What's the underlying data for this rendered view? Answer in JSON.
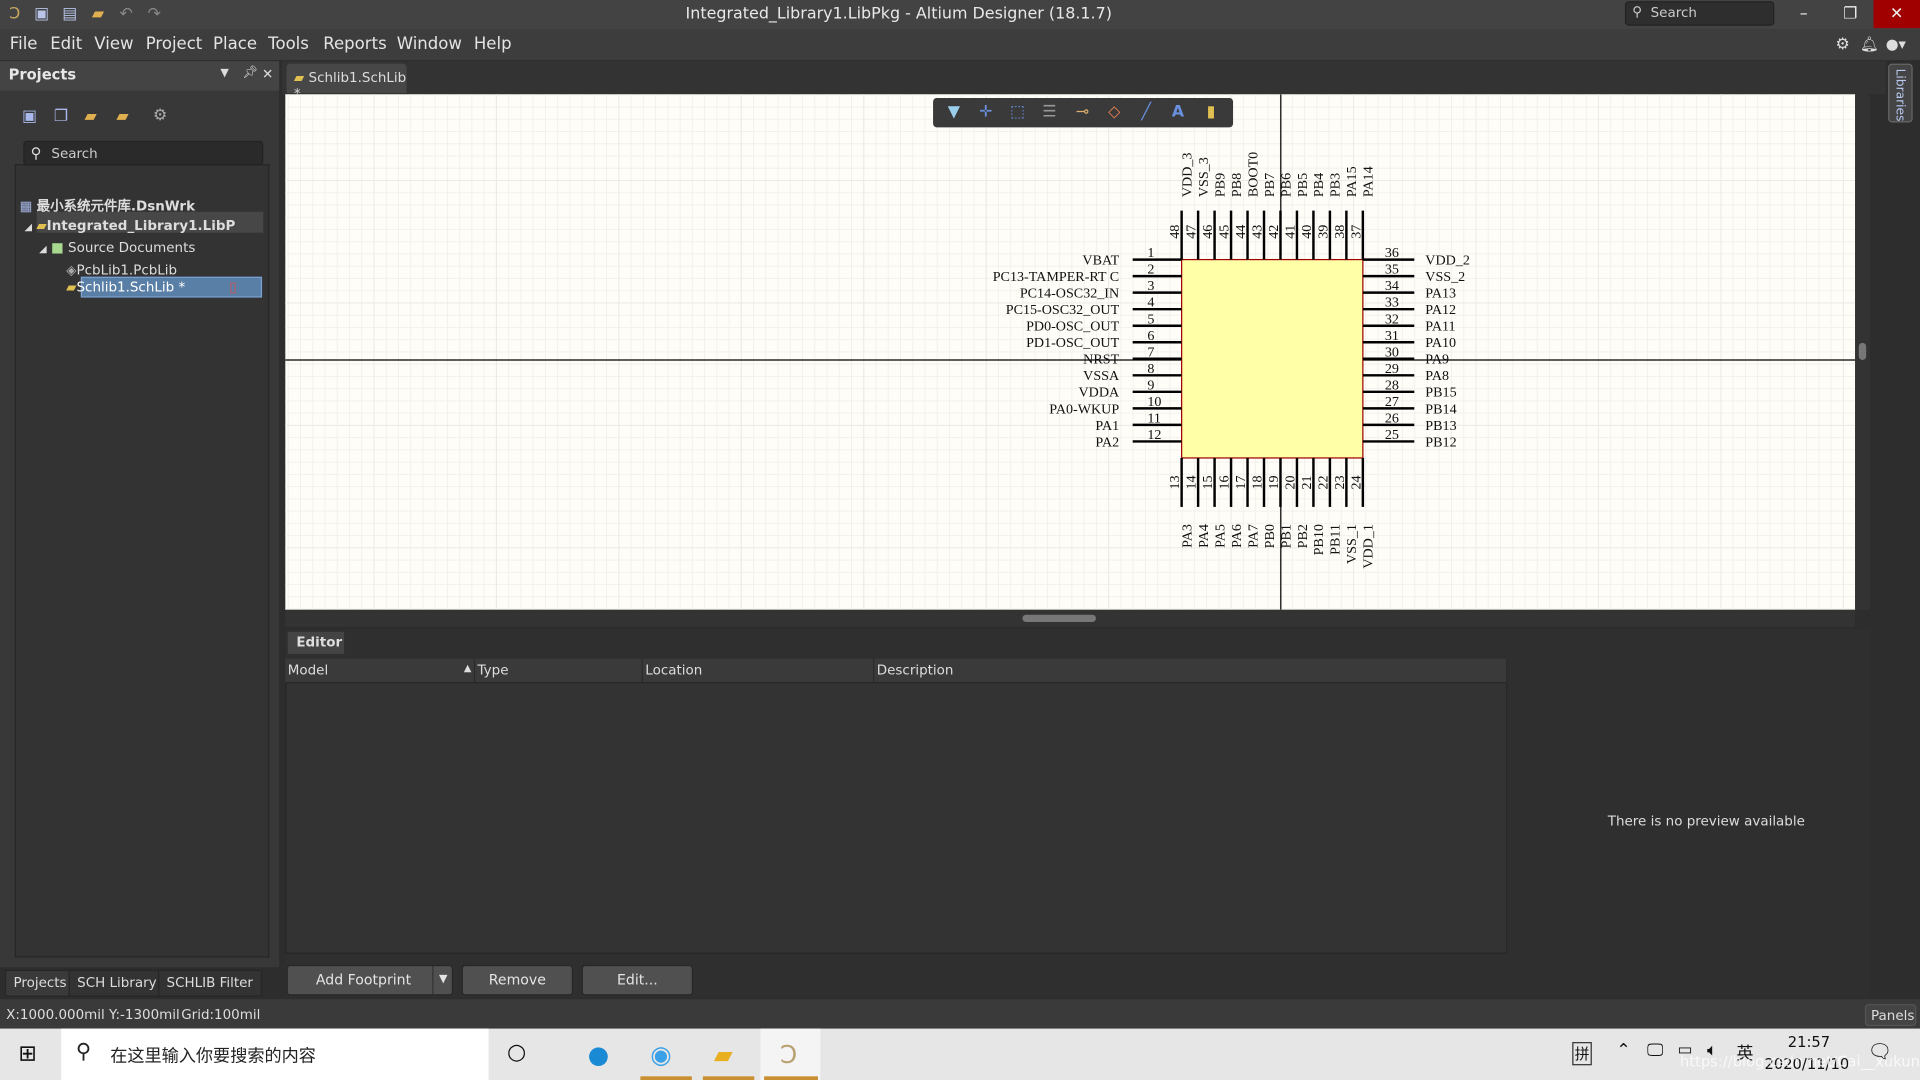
{
  "window": {
    "title": "Integrated_Library1.LibPkg - Altium Designer (18.1.7)",
    "search_placeholder": "Search",
    "minimize": "–",
    "restore": "❐",
    "close": "✕"
  },
  "quick_access": [
    {
      "icon": "altium-logo-icon"
    },
    {
      "icon": "save-icon"
    },
    {
      "icon": "save-all-icon"
    },
    {
      "icon": "open-icon"
    },
    {
      "icon": "undo-icon"
    },
    {
      "icon": "redo-icon"
    }
  ],
  "menu": [
    "File",
    "Edit",
    "View",
    "Project",
    "Place",
    "Tools",
    "Reports",
    "Window",
    "Help"
  ],
  "projects_panel": {
    "title": "Projects",
    "search_placeholder": "Search",
    "tree": [
      {
        "label": "最小系统元件库.DsnWrk",
        "level": 0,
        "bold": true
      },
      {
        "label": "Integrated_Library1.LibP",
        "level": 1,
        "bold": true,
        "expanded": true
      },
      {
        "label": "Source Documents",
        "level": 2,
        "expanded": true
      },
      {
        "label": "PcbLib1.PcbLib",
        "level": 3
      },
      {
        "label": "Schlib1.SchLib *",
        "level": 3,
        "selected": true
      }
    ],
    "bottom_tabs": [
      "Projects",
      "SCH Library",
      "SCHLIB Filter"
    ]
  },
  "doc_tab": "Schlib1.SchLib *",
  "right_strip": "Libraries",
  "schematic": {
    "body_color": "#ffffa8",
    "border_color": "#a00000",
    "left_pins": [
      {
        "num": "1",
        "name": "VBAT"
      },
      {
        "num": "2",
        "name": "PC13-TAMPER-RT C"
      },
      {
        "num": "3",
        "name": "PC14-OSC32_IN"
      },
      {
        "num": "4",
        "name": "PC15-OSC32_OUT"
      },
      {
        "num": "5",
        "name": "PD0-OSC_OUT"
      },
      {
        "num": "6",
        "name": "PD1-OSC_OUT"
      },
      {
        "num": "7",
        "name": "NRST"
      },
      {
        "num": "8",
        "name": "VSSA"
      },
      {
        "num": "9",
        "name": "VDDA"
      },
      {
        "num": "10",
        "name": "PA0-WKUP"
      },
      {
        "num": "11",
        "name": "PA1"
      },
      {
        "num": "12",
        "name": "PA2"
      }
    ],
    "right_pins": [
      {
        "num": "36",
        "name": "VDD_2"
      },
      {
        "num": "35",
        "name": "VSS_2"
      },
      {
        "num": "34",
        "name": "PA13"
      },
      {
        "num": "33",
        "name": "PA12"
      },
      {
        "num": "32",
        "name": "PA11"
      },
      {
        "num": "31",
        "name": "PA10"
      },
      {
        "num": "30",
        "name": "PA9"
      },
      {
        "num": "29",
        "name": "PA8"
      },
      {
        "num": "28",
        "name": "PB15"
      },
      {
        "num": "27",
        "name": "PB14"
      },
      {
        "num": "26",
        "name": "PB13"
      },
      {
        "num": "25",
        "name": "PB12"
      }
    ],
    "top_pins": [
      {
        "num": "48",
        "name": "VDD_3"
      },
      {
        "num": "47",
        "name": "VSS_3"
      },
      {
        "num": "46",
        "name": "PB9"
      },
      {
        "num": "45",
        "name": "PB8"
      },
      {
        "num": "44",
        "name": "BOOT0"
      },
      {
        "num": "43",
        "name": "PB7"
      },
      {
        "num": "42",
        "name": "PB6"
      },
      {
        "num": "41",
        "name": "PB5"
      },
      {
        "num": "40",
        "name": "PB4"
      },
      {
        "num": "39",
        "name": "PB3"
      },
      {
        "num": "38",
        "name": "PA15"
      },
      {
        "num": "37",
        "name": "PA14"
      }
    ],
    "bottom_pins": [
      {
        "num": "13",
        "name": "PA3"
      },
      {
        "num": "14",
        "name": "PA4"
      },
      {
        "num": "15",
        "name": "PA5"
      },
      {
        "num": "16",
        "name": "PA6"
      },
      {
        "num": "17",
        "name": "PA7"
      },
      {
        "num": "18",
        "name": "PB0"
      },
      {
        "num": "19",
        "name": "PB1"
      },
      {
        "num": "20",
        "name": "PB2"
      },
      {
        "num": "21",
        "name": "PB10"
      },
      {
        "num": "22",
        "name": "PB11"
      },
      {
        "num": "23",
        "name": "VSS_1"
      },
      {
        "num": "24",
        "name": "VDD_1"
      }
    ]
  },
  "active_bar": [
    {
      "icon": "filter-icon"
    },
    {
      "icon": "move-icon"
    },
    {
      "icon": "select-rect-icon"
    },
    {
      "icon": "align-icon"
    },
    {
      "icon": "place-pin-icon"
    },
    {
      "icon": "eraser-icon"
    },
    {
      "icon": "line-icon"
    },
    {
      "icon": "text-icon"
    },
    {
      "icon": "part-icon"
    }
  ],
  "editor": {
    "tab": "Editor",
    "columns": [
      "Model",
      "Type",
      "Location",
      "Description"
    ],
    "preview": "There is no preview available",
    "buttons": {
      "add": "Add Footprint",
      "remove": "Remove",
      "edit": "Edit..."
    }
  },
  "status": {
    "coords": "X:1000.000mil Y:-1300mil",
    "grid": "Grid:100mil",
    "panels": "Panels"
  },
  "taskbar": {
    "search_placeholder": "在这里输入你要搜索的内容",
    "ime": "拼",
    "lang": "英",
    "time": "21:57",
    "date": "2020/11/10",
    "watermark": "https://blog.csdn.net/Cai__xukun"
  }
}
